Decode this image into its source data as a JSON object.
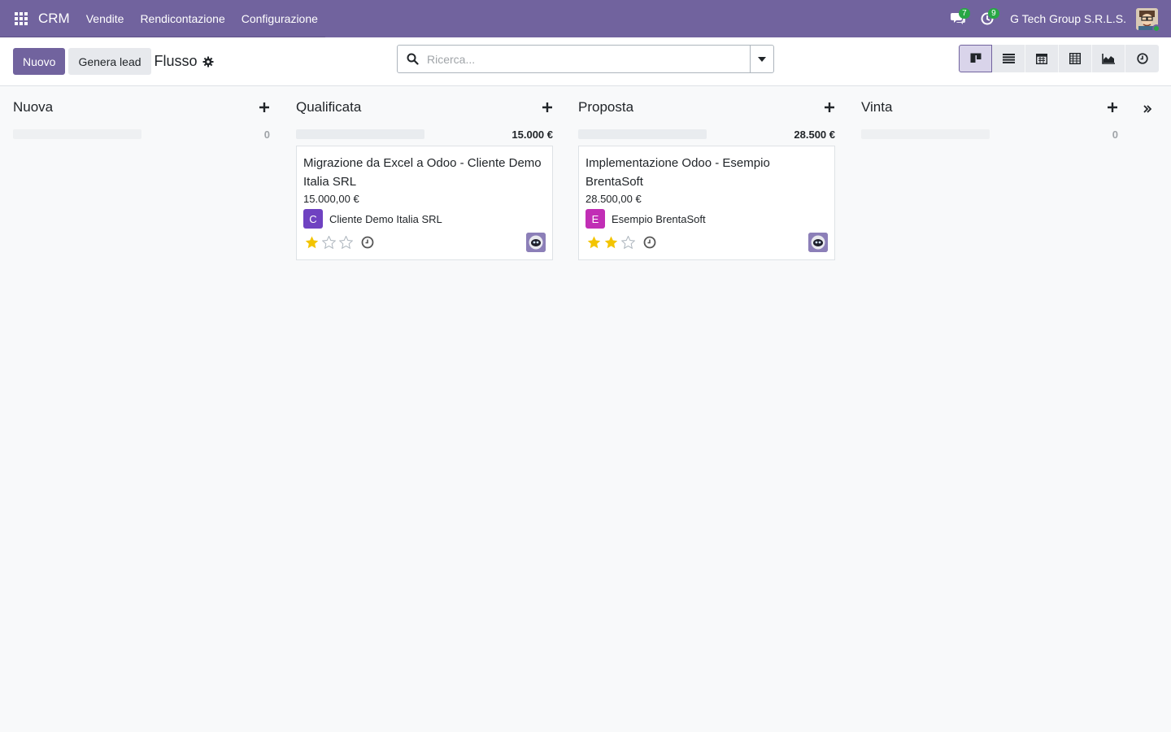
{
  "navbar": {
    "app_name": "CRM",
    "menu": [
      "Vendite",
      "Rendicontazione",
      "Configurazione"
    ],
    "messages_count": "7",
    "activities_count": "9",
    "company": "G Tech Group S.R.L.S.",
    "colors": {
      "bar": "#71639e",
      "badge": "#28a745"
    }
  },
  "control_panel": {
    "new_label": "Nuovo",
    "generate_label": "Genera lead",
    "breadcrumb": "Flusso",
    "search_placeholder": "Ricerca...",
    "views": [
      "kanban-icon",
      "list-icon",
      "calendar-icon",
      "pivot-icon",
      "graph-icon",
      "activity-icon"
    ],
    "active_view": "kanban"
  },
  "kanban": {
    "columns": [
      {
        "title": "Nuova",
        "sum": "0"
      },
      {
        "title": "Qualificata",
        "sum": "15.000 €"
      },
      {
        "title": "Proposta",
        "sum": "28.500 €"
      },
      {
        "title": "Vinta",
        "sum": "0"
      }
    ],
    "cards": [
      {
        "title": "Migrazione da Excel a Odoo - Cliente Demo Italia SRL",
        "amount": "15.000,00 €",
        "partner_initial": "C",
        "partner": "Cliente Demo Italia SRL",
        "partner_color": "#6f42c1",
        "stars": 1
      },
      {
        "title": "Implementazione Odoo - Esempio BrentaSoft",
        "amount": "28.500,00 €",
        "partner_initial": "E",
        "partner": "Esempio BrentaSoft",
        "partner_color": "#c12eb5",
        "stars": 2
      }
    ]
  }
}
